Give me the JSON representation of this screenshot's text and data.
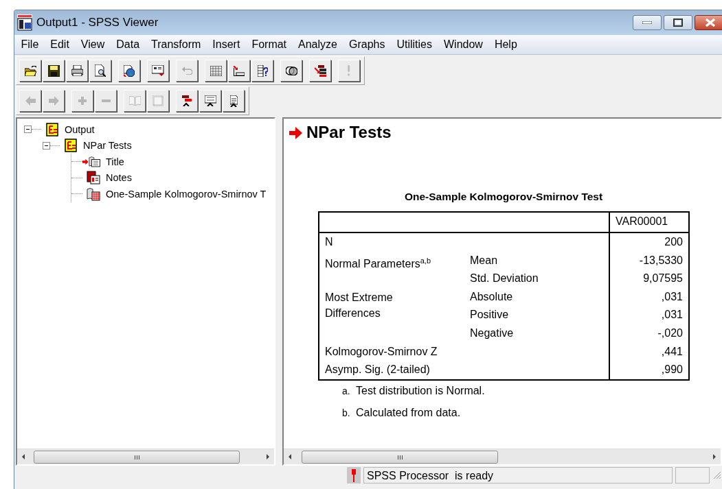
{
  "window": {
    "title": "Output1 - SPSS Viewer"
  },
  "menu": [
    "File",
    "Edit",
    "View",
    "Data",
    "Transform",
    "Insert",
    "Format",
    "Analyze",
    "Graphs",
    "Utilities",
    "Window",
    "Help"
  ],
  "toolbars": [
    {
      "groups": [
        [
          {
            "kind": "open",
            "disabled": false
          },
          {
            "kind": "save",
            "disabled": false
          },
          {
            "kind": "print",
            "disabled": false
          },
          {
            "kind": "preview",
            "disabled": false
          }
        ],
        [
          {
            "kind": "export",
            "disabled": false
          }
        ],
        [
          {
            "kind": "dialog",
            "disabled": false
          }
        ],
        [
          {
            "kind": "undo",
            "disabled": true
          }
        ],
        [
          {
            "kind": "grid",
            "disabled": false
          },
          {
            "kind": "insert-var",
            "disabled": false
          },
          {
            "kind": "var-info",
            "disabled": false
          }
        ],
        [
          {
            "kind": "circles",
            "disabled": false
          }
        ],
        [
          {
            "kind": "stack",
            "disabled": false
          }
        ],
        [
          {
            "kind": "run",
            "disabled": true
          }
        ]
      ]
    },
    {
      "groups": [
        [
          {
            "kind": "back",
            "disabled": true
          },
          {
            "kind": "forward",
            "disabled": true
          }
        ],
        [
          {
            "kind": "expand",
            "disabled": true
          },
          {
            "kind": "collapse",
            "disabled": true
          }
        ],
        [
          {
            "kind": "book",
            "disabled": true
          },
          {
            "kind": "page",
            "disabled": true
          }
        ],
        [
          {
            "kind": "heading",
            "disabled": false
          },
          {
            "kind": "title",
            "disabled": false
          },
          {
            "kind": "text",
            "disabled": false
          }
        ]
      ]
    }
  ],
  "tree": [
    {
      "label": "Output",
      "kind": "log",
      "expanded": true,
      "current": false,
      "children": [
        {
          "label": "NPar Tests",
          "kind": "log",
          "expanded": true,
          "current": false,
          "children": [
            {
              "label": "Title",
              "kind": "title",
              "current": true
            },
            {
              "label": "Notes",
              "kind": "notes",
              "current": false
            },
            {
              "label": "One-Sample Kolmogorov-Smirnov T",
              "kind": "table",
              "current": false
            }
          ]
        }
      ]
    }
  ],
  "output": {
    "heading": "NPar Tests",
    "table": {
      "title": "One-Sample Kolmogorov-Smirnov Test",
      "columns": [
        "VAR00001"
      ],
      "groups": [
        {
          "label": "N",
          "rows": [
            {
              "value": "200"
            }
          ]
        },
        {
          "label": "Normal Parameters$^{a,b}$",
          "rows": [
            {
              "stat": "Mean",
              "value": "-13,5330"
            },
            {
              "stat": "Std. Deviation",
              "value": "9,07595"
            }
          ]
        },
        {
          "label": "Most Extreme Differences",
          "rows": [
            {
              "stat": "Absolute",
              "value": ",031"
            },
            {
              "stat": "Positive",
              "value": ",031"
            },
            {
              "stat": "Negative",
              "value": "-,020"
            }
          ]
        },
        {
          "label": "Kolmogorov-Smirnov Z",
          "rows": [
            {
              "value": ",441"
            }
          ]
        },
        {
          "label": "Asymp. Sig. (2-tailed)",
          "rows": [
            {
              "value": ",990"
            }
          ]
        }
      ],
      "footnotes": [
        {
          "mark": "a.",
          "text": "Test distribution is Normal."
        },
        {
          "mark": "b.",
          "text": "Calculated from data."
        }
      ]
    }
  },
  "status_bar": {
    "text": "SPSS Processor  is ready"
  }
}
